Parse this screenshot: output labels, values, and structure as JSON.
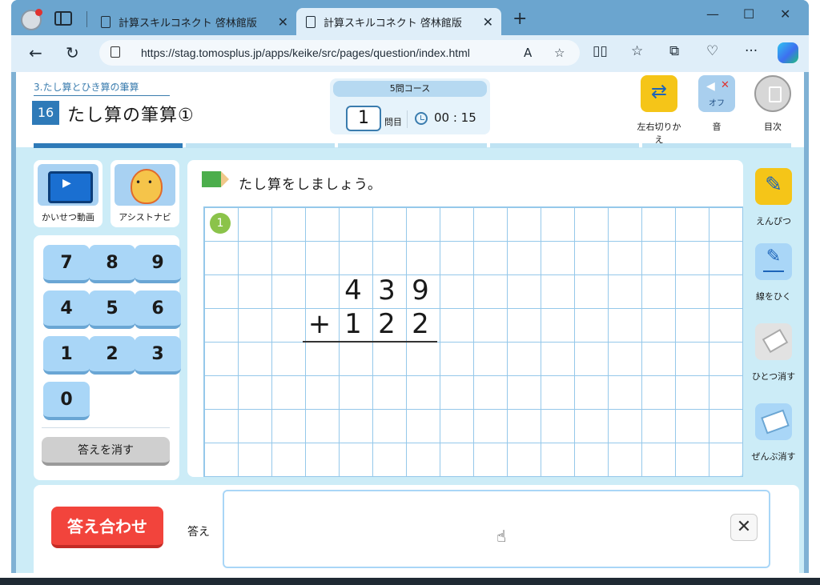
{
  "browser": {
    "tabs": [
      {
        "title": "計算スキルコネクト 啓林館版"
      },
      {
        "title": "計算スキルコネクト 啓林館版"
      }
    ],
    "url": "https://stag.tomosplus.jp/apps/keike/src/pages/question/index.html",
    "window_controls": {
      "minimize": "—",
      "maximize": "☐",
      "close": "✕"
    }
  },
  "header": {
    "unit": "3.たし算とひき算の筆算",
    "lesson_number": "16",
    "lesson_title": "たし算の筆算①",
    "course": "5問コース",
    "question_number": "1",
    "question_unit": "問目",
    "timer": "00 : 15",
    "buttons": {
      "swap": "左右切りかえ",
      "sound": "音",
      "sound_state": "オフ",
      "menu": "目次"
    },
    "progress": {
      "total": 5,
      "done": 1
    }
  },
  "left": {
    "video_label": "かいせつ動画",
    "assist_label": "アシストナビ",
    "keys": [
      "7",
      "8",
      "9",
      "4",
      "5",
      "6",
      "1",
      "2",
      "3",
      "0"
    ],
    "clear_label": "答えを消す"
  },
  "work": {
    "instruction": "たし算をしましょう。",
    "badge": "1",
    "problem": {
      "top": [
        "4",
        "3",
        "9"
      ],
      "operator": "+",
      "bottom": [
        "1",
        "2",
        "2"
      ]
    }
  },
  "tools": {
    "pencil": "えんぴつ",
    "line": "線をひく",
    "erase_one": "ひとつ消す",
    "erase_all": "ぜんぶ消す"
  },
  "answer": {
    "check_label": "答え合わせ",
    "label": "答え",
    "value": "",
    "clear": "✕"
  }
}
